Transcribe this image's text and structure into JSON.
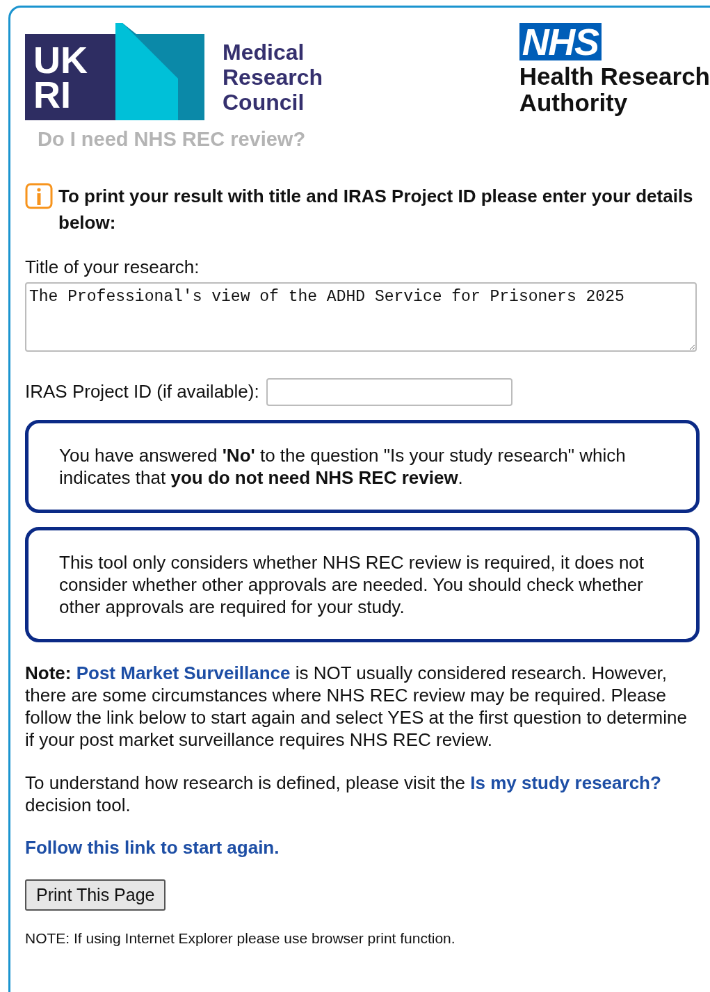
{
  "header": {
    "ukri_logo": {
      "letters": [
        "UK",
        "RI"
      ],
      "name_lines": [
        "Medical",
        "Research",
        "Council"
      ]
    },
    "nhs_logo": {
      "badge": "NHS",
      "name_lines": [
        "Health Research",
        "Authority"
      ]
    }
  },
  "page_title": "Do I need NHS REC review?",
  "notice": "To print your result with title and IRAS Project ID please enter your details below:",
  "form": {
    "title_label": "Title of your research:",
    "title_value": "The Professional's view of the ADHD Service for Prisoners 2025",
    "iras_label": "IRAS Project ID (if available):"
  },
  "result_boxes": [
    "You have answered **'No'** to the question \"Is your study research\" which indicates that **you do not need NHS REC review**.",
    "This tool only considers whether NHS REC review is required, it does not consider whether other approvals are needed. You should check whether other approvals are required for your study."
  ],
  "paragraphs": [
    [
      {
        "kind": "bold",
        "text": "Note:"
      },
      {
        "kind": "link",
        "text": "Post Market Surveillance"
      },
      {
        "kind": "text",
        "text": "is NOT usually considered research. However, there are some circumstances where NHS REC review may be required. Please follow the link below to start again and select YES at the first question to determine if your post market surveillance requires NHS REC review."
      }
    ],
    [
      {
        "kind": "text",
        "text": "To understand how research is defined, please visit the"
      },
      {
        "kind": "link",
        "text": "Is my study research?"
      },
      {
        "kind": "text",
        "text": "decision tool."
      }
    ]
  ],
  "restart_link": "Follow this link to start again.",
  "print_button": "Print This Page",
  "footnote": "NOTE: If using Internet Explorer please use browser print function."
}
